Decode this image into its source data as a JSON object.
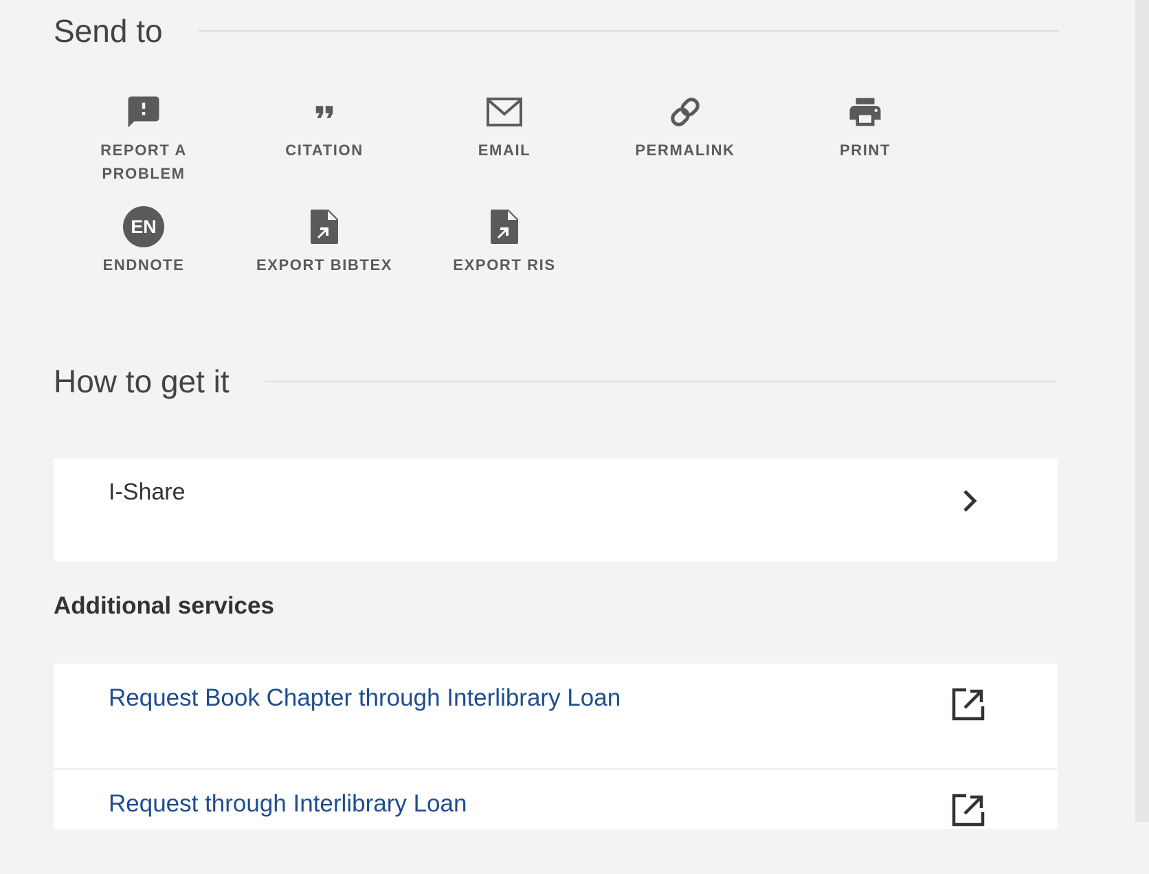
{
  "send_to": {
    "title": "Send to",
    "actions": [
      {
        "id": "report",
        "label_line1": "REPORT A",
        "label_line2": "PROBLEM",
        "icon": "report-problem-icon"
      },
      {
        "id": "citation",
        "label": "CITATION",
        "icon": "quote-icon"
      },
      {
        "id": "email",
        "label": "EMAIL",
        "icon": "envelope-icon"
      },
      {
        "id": "permalink",
        "label": "PERMALINK",
        "icon": "link-icon"
      },
      {
        "id": "print",
        "label": "PRINT",
        "icon": "printer-icon"
      },
      {
        "id": "endnote",
        "label": "ENDNOTE",
        "icon": "endnote-icon",
        "badge": "EN"
      },
      {
        "id": "bibtex",
        "label": "EXPORT BIBTEX",
        "icon": "file-export-icon"
      },
      {
        "id": "ris",
        "label": "EXPORT RIS",
        "icon": "file-export-icon"
      }
    ]
  },
  "how_to_get_it": {
    "title": "How to get it",
    "ishare": {
      "label": "I-Share",
      "icon": "chevron-right-icon"
    }
  },
  "additional_services": {
    "title": "Additional services",
    "links": [
      {
        "label": "Request Book Chapter through Interlibrary Loan",
        "icon": "external-link-icon"
      },
      {
        "label": "Request through Interlibrary Loan",
        "icon": "external-link-icon"
      }
    ]
  },
  "colors": {
    "background": "#f3f3f3",
    "card": "#ffffff",
    "icon": "#5a5a5a",
    "link": "#1f4d8f",
    "rule": "#dcdcdc"
  }
}
